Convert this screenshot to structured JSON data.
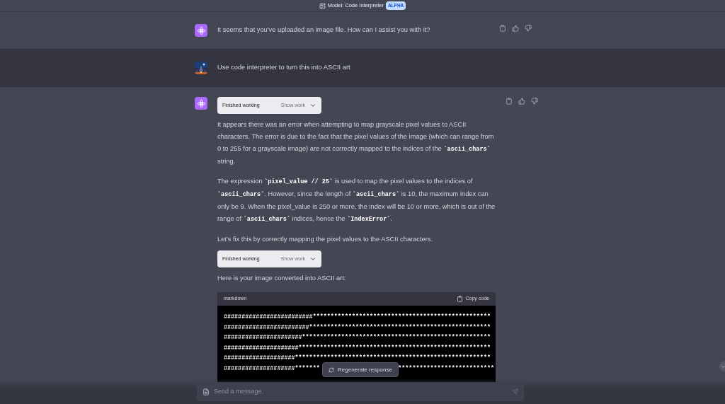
{
  "header": {
    "model_label": "Model: Code Interpreter",
    "badge": "ALPHA"
  },
  "messages": [
    {
      "kind": "assistant",
      "actions": true,
      "blocks": [
        {
          "kind": "paragraph",
          "segments": [
            {
              "kind": "text",
              "text": "It seems that you've uploaded an image file. How can I assist you with it?"
            }
          ]
        }
      ]
    },
    {
      "kind": "user",
      "actions": false,
      "blocks": [
        {
          "kind": "paragraph",
          "segments": [
            {
              "kind": "text",
              "text": "Use code interpreter to turn this into ASCII art"
            }
          ]
        }
      ]
    },
    {
      "kind": "assistant",
      "actions": true,
      "blocks": [
        {
          "kind": "work",
          "label": "Finished working",
          "action": "Show work"
        },
        {
          "kind": "paragraph",
          "segments": [
            {
              "kind": "text",
              "text": "It appears there was an error when attempting to map grayscale pixel values to ASCII characters. The error is due to the fact that the pixel values of the image (which can range from 0 to 255 for a grayscale image) are not correctly mapped to the indices of the "
            },
            {
              "kind": "code",
              "text": "`ascii_chars`"
            },
            {
              "kind": "text",
              "text": " string."
            }
          ]
        },
        {
          "kind": "paragraph",
          "segments": [
            {
              "kind": "text",
              "text": "The expression "
            },
            {
              "kind": "code",
              "text": "`pixel_value // 25`"
            },
            {
              "kind": "text",
              "text": " is used to map the pixel values to the indices of "
            },
            {
              "kind": "code",
              "text": "`ascii_chars`"
            },
            {
              "kind": "text",
              "text": ". However, since the length of "
            },
            {
              "kind": "code",
              "text": "`ascii_chars`"
            },
            {
              "kind": "text",
              "text": " is 10, the maximum index can only be 9. When the pixel_value is 250 or more, the index will be 10 or more, which is out of the range of "
            },
            {
              "kind": "code",
              "text": "`ascii_chars`"
            },
            {
              "kind": "text",
              "text": " indices, hence the "
            },
            {
              "kind": "code",
              "text": "`IndexError`"
            },
            {
              "kind": "text",
              "text": "."
            }
          ]
        },
        {
          "kind": "paragraph",
          "segments": [
            {
              "kind": "text",
              "text": "Let's fix this by correctly mapping the pixel values to the ASCII characters."
            }
          ]
        },
        {
          "kind": "work",
          "label": "Finished working",
          "action": "Show work"
        },
        {
          "kind": "paragraph",
          "segments": [
            {
              "kind": "text",
              "text": "Here is your image converted into ASCII art:"
            }
          ]
        },
        {
          "kind": "code",
          "language": "markdown",
          "copy_label": "Copy code",
          "lines": [
            "#########################**************************************************",
            "########################***************************************************",
            "######################*****************************************************",
            "#####################******************************************************",
            "####################*******************************************************"
          ],
          "covered_line": {
            "left": "####################*******",
            "right": "***************************"
          }
        }
      ]
    }
  ],
  "regenerate": "Regenerate response",
  "composer": {
    "placeholder": "Send a message."
  }
}
